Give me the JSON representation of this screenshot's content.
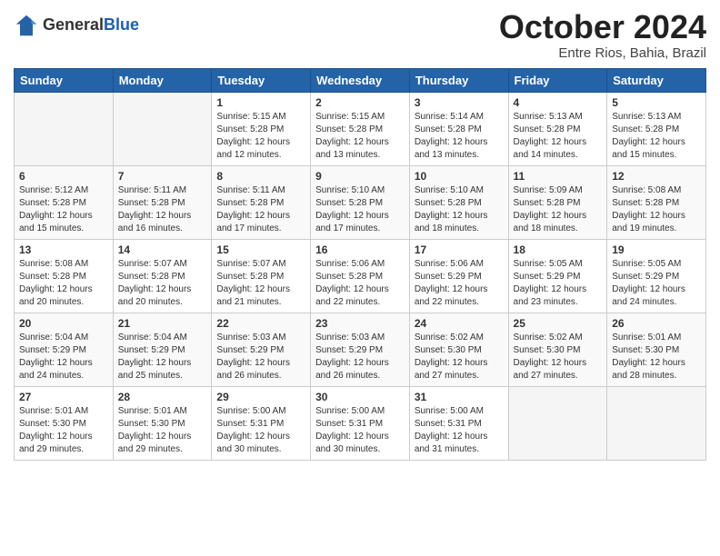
{
  "header": {
    "logo_general": "General",
    "logo_blue": "Blue",
    "month_title": "October 2024",
    "location": "Entre Rios, Bahia, Brazil"
  },
  "days_of_week": [
    "Sunday",
    "Monday",
    "Tuesday",
    "Wednesday",
    "Thursday",
    "Friday",
    "Saturday"
  ],
  "weeks": [
    [
      {
        "day": "",
        "info": ""
      },
      {
        "day": "",
        "info": ""
      },
      {
        "day": "1",
        "info": "Sunrise: 5:15 AM\nSunset: 5:28 PM\nDaylight: 12 hours and 12 minutes."
      },
      {
        "day": "2",
        "info": "Sunrise: 5:15 AM\nSunset: 5:28 PM\nDaylight: 12 hours and 13 minutes."
      },
      {
        "day": "3",
        "info": "Sunrise: 5:14 AM\nSunset: 5:28 PM\nDaylight: 12 hours and 13 minutes."
      },
      {
        "day": "4",
        "info": "Sunrise: 5:13 AM\nSunset: 5:28 PM\nDaylight: 12 hours and 14 minutes."
      },
      {
        "day": "5",
        "info": "Sunrise: 5:13 AM\nSunset: 5:28 PM\nDaylight: 12 hours and 15 minutes."
      }
    ],
    [
      {
        "day": "6",
        "info": "Sunrise: 5:12 AM\nSunset: 5:28 PM\nDaylight: 12 hours and 15 minutes."
      },
      {
        "day": "7",
        "info": "Sunrise: 5:11 AM\nSunset: 5:28 PM\nDaylight: 12 hours and 16 minutes."
      },
      {
        "day": "8",
        "info": "Sunrise: 5:11 AM\nSunset: 5:28 PM\nDaylight: 12 hours and 17 minutes."
      },
      {
        "day": "9",
        "info": "Sunrise: 5:10 AM\nSunset: 5:28 PM\nDaylight: 12 hours and 17 minutes."
      },
      {
        "day": "10",
        "info": "Sunrise: 5:10 AM\nSunset: 5:28 PM\nDaylight: 12 hours and 18 minutes."
      },
      {
        "day": "11",
        "info": "Sunrise: 5:09 AM\nSunset: 5:28 PM\nDaylight: 12 hours and 18 minutes."
      },
      {
        "day": "12",
        "info": "Sunrise: 5:08 AM\nSunset: 5:28 PM\nDaylight: 12 hours and 19 minutes."
      }
    ],
    [
      {
        "day": "13",
        "info": "Sunrise: 5:08 AM\nSunset: 5:28 PM\nDaylight: 12 hours and 20 minutes."
      },
      {
        "day": "14",
        "info": "Sunrise: 5:07 AM\nSunset: 5:28 PM\nDaylight: 12 hours and 20 minutes."
      },
      {
        "day": "15",
        "info": "Sunrise: 5:07 AM\nSunset: 5:28 PM\nDaylight: 12 hours and 21 minutes."
      },
      {
        "day": "16",
        "info": "Sunrise: 5:06 AM\nSunset: 5:28 PM\nDaylight: 12 hours and 22 minutes."
      },
      {
        "day": "17",
        "info": "Sunrise: 5:06 AM\nSunset: 5:29 PM\nDaylight: 12 hours and 22 minutes."
      },
      {
        "day": "18",
        "info": "Sunrise: 5:05 AM\nSunset: 5:29 PM\nDaylight: 12 hours and 23 minutes."
      },
      {
        "day": "19",
        "info": "Sunrise: 5:05 AM\nSunset: 5:29 PM\nDaylight: 12 hours and 24 minutes."
      }
    ],
    [
      {
        "day": "20",
        "info": "Sunrise: 5:04 AM\nSunset: 5:29 PM\nDaylight: 12 hours and 24 minutes."
      },
      {
        "day": "21",
        "info": "Sunrise: 5:04 AM\nSunset: 5:29 PM\nDaylight: 12 hours and 25 minutes."
      },
      {
        "day": "22",
        "info": "Sunrise: 5:03 AM\nSunset: 5:29 PM\nDaylight: 12 hours and 26 minutes."
      },
      {
        "day": "23",
        "info": "Sunrise: 5:03 AM\nSunset: 5:29 PM\nDaylight: 12 hours and 26 minutes."
      },
      {
        "day": "24",
        "info": "Sunrise: 5:02 AM\nSunset: 5:30 PM\nDaylight: 12 hours and 27 minutes."
      },
      {
        "day": "25",
        "info": "Sunrise: 5:02 AM\nSunset: 5:30 PM\nDaylight: 12 hours and 27 minutes."
      },
      {
        "day": "26",
        "info": "Sunrise: 5:01 AM\nSunset: 5:30 PM\nDaylight: 12 hours and 28 minutes."
      }
    ],
    [
      {
        "day": "27",
        "info": "Sunrise: 5:01 AM\nSunset: 5:30 PM\nDaylight: 12 hours and 29 minutes."
      },
      {
        "day": "28",
        "info": "Sunrise: 5:01 AM\nSunset: 5:30 PM\nDaylight: 12 hours and 29 minutes."
      },
      {
        "day": "29",
        "info": "Sunrise: 5:00 AM\nSunset: 5:31 PM\nDaylight: 12 hours and 30 minutes."
      },
      {
        "day": "30",
        "info": "Sunrise: 5:00 AM\nSunset: 5:31 PM\nDaylight: 12 hours and 30 minutes."
      },
      {
        "day": "31",
        "info": "Sunrise: 5:00 AM\nSunset: 5:31 PM\nDaylight: 12 hours and 31 minutes."
      },
      {
        "day": "",
        "info": ""
      },
      {
        "day": "",
        "info": ""
      }
    ]
  ]
}
